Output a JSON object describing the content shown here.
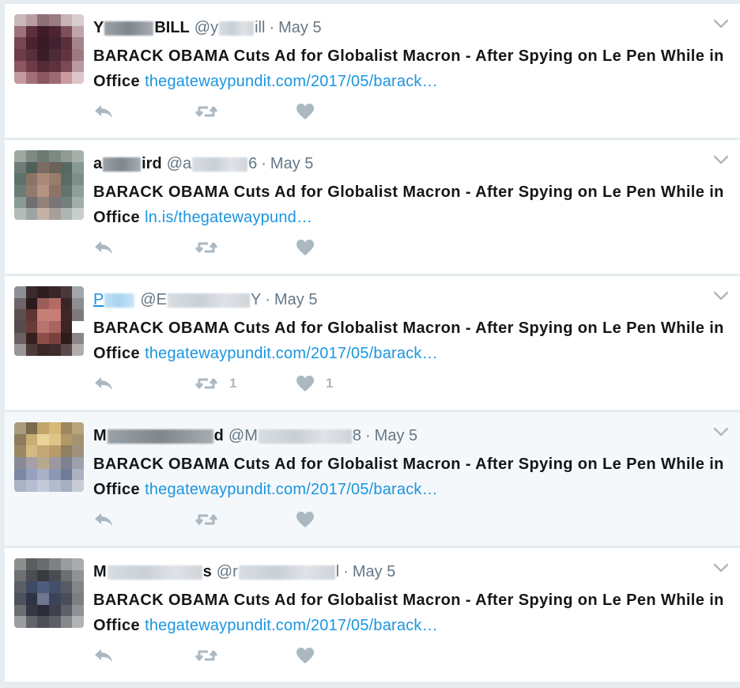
{
  "tweets": [
    {
      "name_pre": "Y",
      "name_post": "BILL",
      "handle_pre": "@y",
      "handle_post": "ill",
      "separator": "·",
      "date": "May 5",
      "text": "BARACK OBAMA Cuts Ad for Globalist Macron - After Spying on Le Pen While in Office",
      "link": "thegatewaypundit.com/2017/05/barack…",
      "retweet_count": "",
      "like_count": ""
    },
    {
      "name_pre": "a",
      "name_post": "ird",
      "handle_pre": "@a",
      "handle_post": "6",
      "separator": "·",
      "date": "May 5",
      "text": "BARACK OBAMA Cuts Ad for Globalist Macron - After Spying on Le Pen While in Office",
      "link": "ln.is/thegatewaypund…",
      "retweet_count": "",
      "like_count": ""
    },
    {
      "name_pre": "P",
      "name_post": "",
      "handle_pre": "@E",
      "handle_post": "Y",
      "separator": "·",
      "date": "May 5",
      "text": "BARACK OBAMA Cuts Ad for Globalist Macron - After Spying on Le Pen While in Office",
      "link": "thegatewaypundit.com/2017/05/barack…",
      "retweet_count": "1",
      "like_count": "1"
    },
    {
      "name_pre": "M",
      "name_post": "d",
      "handle_pre": "@M",
      "handle_post": "8",
      "separator": "·",
      "date": "May 5",
      "text": "BARACK OBAMA Cuts Ad for Globalist Macron - After Spying on Le Pen While in Office",
      "link": "thegatewaypundit.com/2017/05/barack…",
      "retweet_count": "",
      "like_count": ""
    },
    {
      "name_pre": "M",
      "name_post": "s",
      "handle_pre": "@r",
      "handle_post": "l",
      "separator": "·",
      "date": "May 5",
      "text": "BARACK OBAMA Cuts Ad for Globalist Macron - After Spying on Le Pen While in Office",
      "link": "thegatewaypundit.com/2017/05/barack…",
      "retweet_count": "",
      "like_count": ""
    }
  ],
  "icons": {
    "reply": "reply-icon",
    "retweet": "retweet-icon",
    "like": "heart-icon",
    "menu": "chevron-down-icon"
  },
  "colors": {
    "link": "#1b95e0",
    "secondary_text": "#657786",
    "action_icon": "#aab8c2",
    "background": "#e6ecf0"
  }
}
